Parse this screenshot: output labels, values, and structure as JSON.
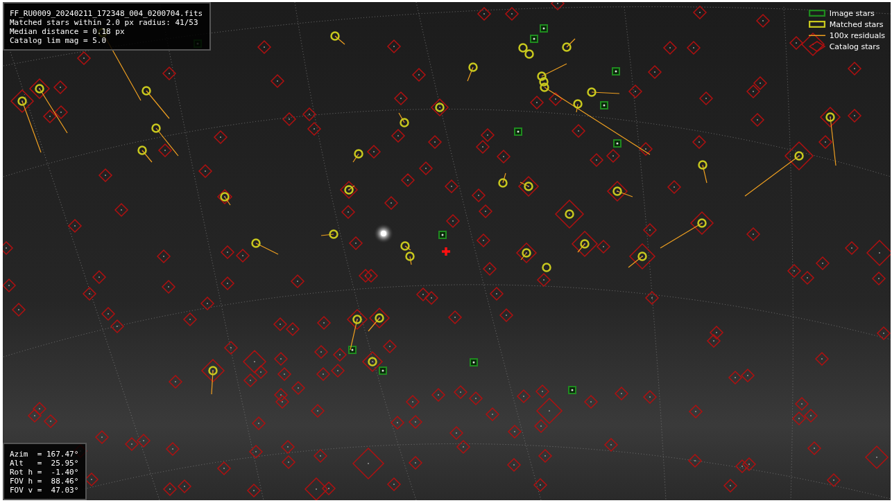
{
  "header_info": {
    "lines": [
      "FF_RU0009_20240211_172348_004_0200704.fits",
      "Matched stars within 2.0 px radius: 41/53",
      "Median distance = 0.18 px",
      "Catalog lim mag = 5.0"
    ]
  },
  "legend": [
    {
      "kind": "box",
      "label": "Image stars",
      "color": "#1f8a1f"
    },
    {
      "kind": "box",
      "label": "Matched stars",
      "color": "#c8c81e"
    },
    {
      "kind": "line",
      "label": "100x residuals",
      "color": "#f0a020"
    },
    {
      "kind": "diamond",
      "label": "Catalog stars",
      "color": "#b01010"
    }
  ],
  "pointing_info": {
    "lines": [
      "Azim  = 167.47°",
      "Alt   =  25.95°",
      "Rot h =  -1.40°",
      "FOV h =  88.46°",
      "FOV v =  47.03°"
    ]
  }
}
